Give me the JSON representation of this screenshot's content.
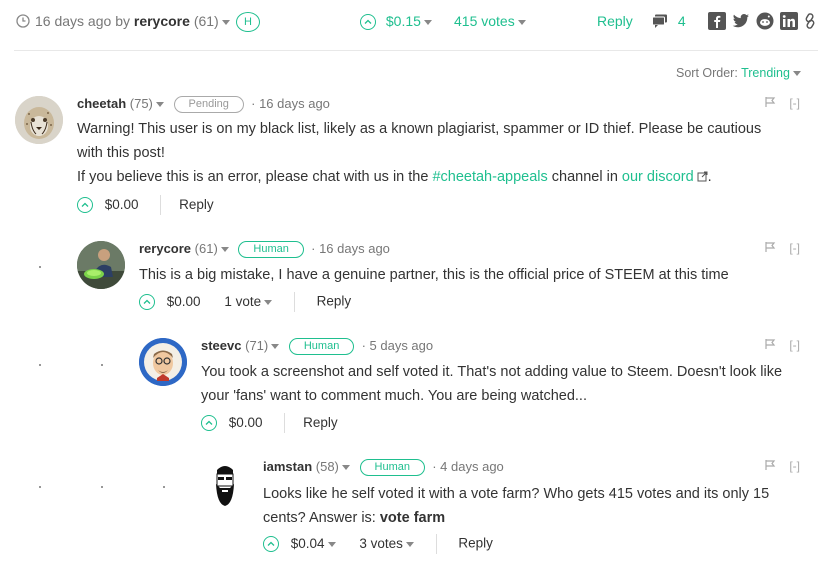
{
  "post_bar": {
    "age": "16 days ago",
    "by_label": "by",
    "author": "rerycore",
    "reputation": "(61)",
    "human_badge": "H",
    "payout": "$0.15",
    "votes": "415 votes",
    "reply": "Reply",
    "comments_count": "4"
  },
  "sort": {
    "label": "Sort Order:",
    "value": "Trending"
  },
  "comments": [
    {
      "author": "cheetah",
      "reputation": "(75)",
      "badge": "Pending",
      "time": "16 days ago",
      "line1": "Warning! This user is on my black list, likely as a known plagiarist, spammer or ID thief. Please be cautious",
      "line2": "with this post!",
      "line3_pre": "If you believe this is an error, please chat with us in the",
      "channel": "#cheetah-appeals",
      "line3_mid": "channel in",
      "discord": "our discord",
      "line3_end": ".",
      "payout": "$0.00",
      "reply": "Reply",
      "collapse": "[-]"
    },
    {
      "author": "rerycore",
      "reputation": "(61)",
      "badge": "Human",
      "time": "16 days ago",
      "line1": "This is a big mistake, I have a genuine partner, this is the official price of STEEM at this time",
      "payout": "$0.00",
      "votes": "1 vote",
      "reply": "Reply",
      "collapse": "[-]"
    },
    {
      "author": "steevc",
      "reputation": "(71)",
      "badge": "Human",
      "time": "5 days ago",
      "line1": "You took a screenshot and self voted it. That's not adding value to Steem. Doesn't look like",
      "line2": "your 'fans' want to comment much. You are being watched...",
      "payout": "$0.00",
      "reply": "Reply",
      "collapse": "[-]"
    },
    {
      "author": "iamstan",
      "reputation": "(58)",
      "badge": "Human",
      "time": "4 days ago",
      "line1": "Looks like he self voted it with a vote farm? Who gets 415 votes and its only 15",
      "line2_pre": "cents? Answer is:",
      "line2_bold": "vote farm",
      "payout": "$0.04",
      "votes": "3 votes",
      "reply": "Reply",
      "collapse": "[-]"
    }
  ],
  "colors": {
    "accent": "#1fbf8f",
    "text": "#333333",
    "muted": "#777777"
  }
}
